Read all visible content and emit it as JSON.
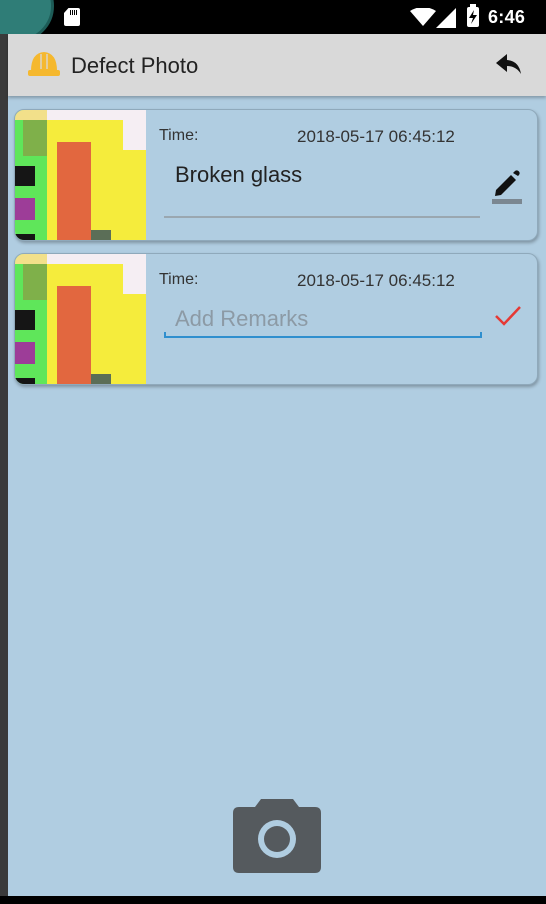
{
  "status_bar": {
    "time": "6:46"
  },
  "app_bar": {
    "title": "Defect Photo",
    "icons": [
      "helmet-icon",
      "back-arrow-icon"
    ]
  },
  "photos": [
    {
      "time_label": "Time:",
      "time_value": "2018-05-17 06:45:12",
      "remark": "Broken glass",
      "action_icon": "edit-icon"
    },
    {
      "time_label": "Time:",
      "time_value": "2018-05-17 06:45:12",
      "remark_placeholder": "Add Remarks",
      "action_icon": "check-icon"
    }
  ],
  "colors": {
    "background": "#b0cde1",
    "app_bar": "#d9d9d9",
    "accent": "#2f8fce",
    "check": "#e53935",
    "helmet": "#f5b82e"
  },
  "camera_icon": "camera-icon"
}
